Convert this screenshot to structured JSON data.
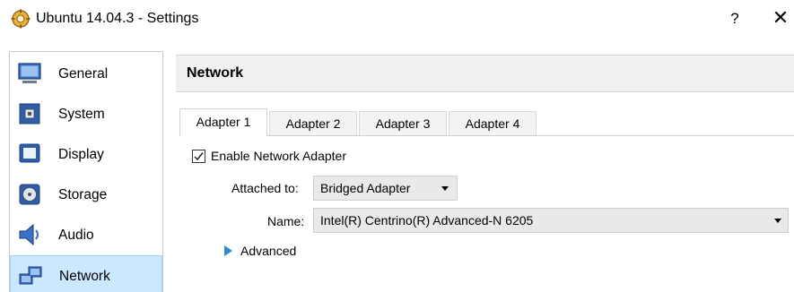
{
  "window": {
    "title": "Ubuntu 14.04.3 - Settings",
    "help": "?",
    "close": "✕"
  },
  "sidebar": {
    "items": [
      {
        "label": "General",
        "icon": "general-icon"
      },
      {
        "label": "System",
        "icon": "system-icon"
      },
      {
        "label": "Display",
        "icon": "display-icon"
      },
      {
        "label": "Storage",
        "icon": "storage-icon"
      },
      {
        "label": "Audio",
        "icon": "audio-icon"
      },
      {
        "label": "Network",
        "icon": "network-icon",
        "selected": true
      }
    ]
  },
  "panel": {
    "title": "Network"
  },
  "tabs": [
    {
      "label": "Adapter 1",
      "active": true
    },
    {
      "label": "Adapter 2"
    },
    {
      "label": "Adapter 3"
    },
    {
      "label": "Adapter 4"
    }
  ],
  "adapter": {
    "enable_label": "Enable Network Adapter",
    "enabled": true,
    "attached_label": "Attached to:",
    "attached_value": "Bridged Adapter",
    "name_label": "Name:",
    "name_value": "Intel(R) Centrino(R) Advanced-N 6205",
    "advanced_label": "Advanced"
  },
  "colors": {
    "selection_bg": "#cce8ff",
    "selection_border": "#99d1ff",
    "accent": "#2a8ad4"
  }
}
